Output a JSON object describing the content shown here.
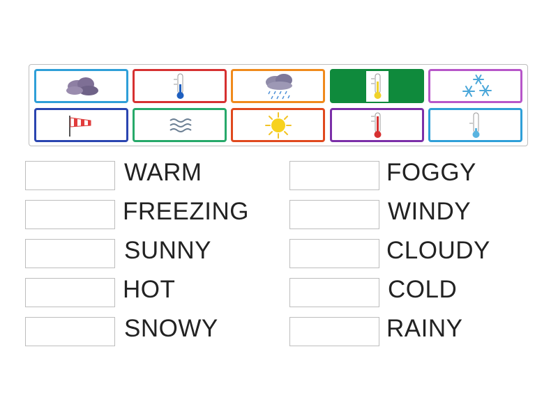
{
  "tiles": [
    {
      "icon": "cloud-icon",
      "border": "#2f9fd8"
    },
    {
      "icon": "cold-thermometer-icon",
      "border": "#d63131"
    },
    {
      "icon": "rain-cloud-icon",
      "border": "#f08a1c"
    },
    {
      "icon": "warm-thermometer-icon",
      "border": "#0f8a3c",
      "filled": true
    },
    {
      "icon": "snowflakes-icon",
      "border": "#b756c9"
    },
    {
      "icon": "windsock-icon",
      "border": "#2a45b0"
    },
    {
      "icon": "fog-icon",
      "border": "#27a96a"
    },
    {
      "icon": "sun-icon",
      "border": "#e0491e"
    },
    {
      "icon": "hot-thermometer-icon",
      "border": "#7b2fa8"
    },
    {
      "icon": "freezing-thermometer-icon",
      "border": "#2f9fd8"
    }
  ],
  "words": {
    "left": [
      "WARM",
      "FREEZING",
      "SUNNY",
      "HOT",
      "SNOWY"
    ],
    "right": [
      "FOGGY",
      "WINDY",
      "CLOUDY",
      "COLD",
      "RAINY"
    ]
  }
}
